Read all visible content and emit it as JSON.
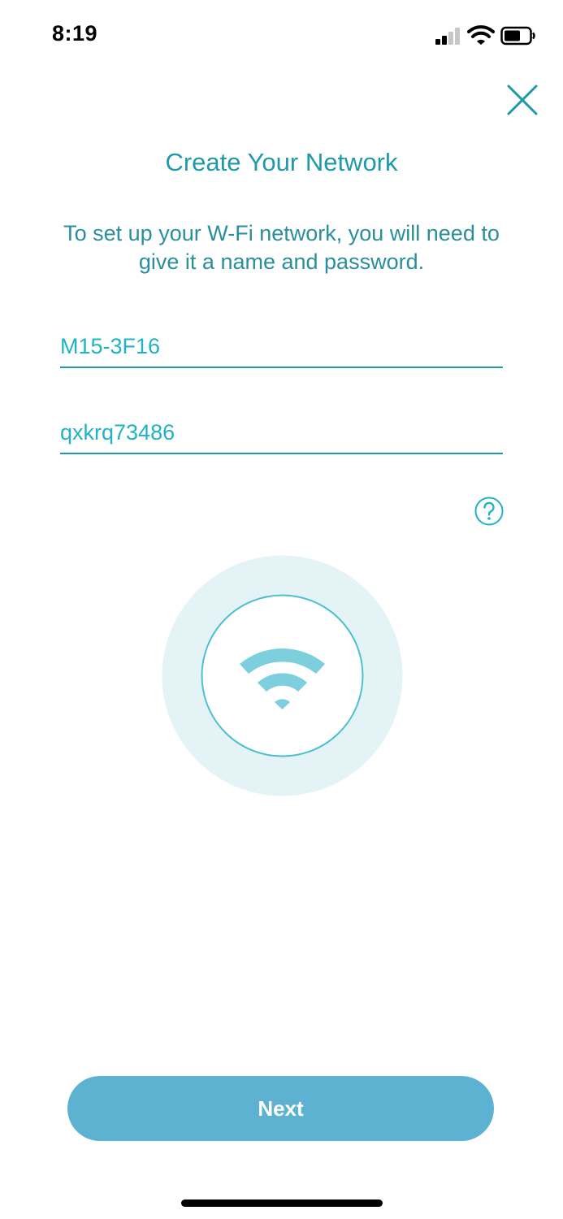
{
  "status_bar": {
    "time": "8:19",
    "signal_icon": "cellular-signal-icon",
    "wifi_icon": "wifi-icon",
    "battery_icon": "battery-icon"
  },
  "header": {
    "close_icon": "close-icon",
    "title": "Create Your Network"
  },
  "content": {
    "description": "To set up your W-Fi network, you will need to give it a name and password.",
    "network_name": {
      "value": "M15-3F16"
    },
    "password": {
      "value": "qxkrq73486"
    },
    "help_icon": "question-mark-icon",
    "illustration_icon": "wifi-icon"
  },
  "footer": {
    "next_label": "Next"
  },
  "colors": {
    "accent": "#1e9aa9",
    "field_text": "#1fb3c4",
    "button": "#5db2d1",
    "illustration_outer": "#e4f3f6",
    "wifi_glyph": "#7dcfde"
  }
}
